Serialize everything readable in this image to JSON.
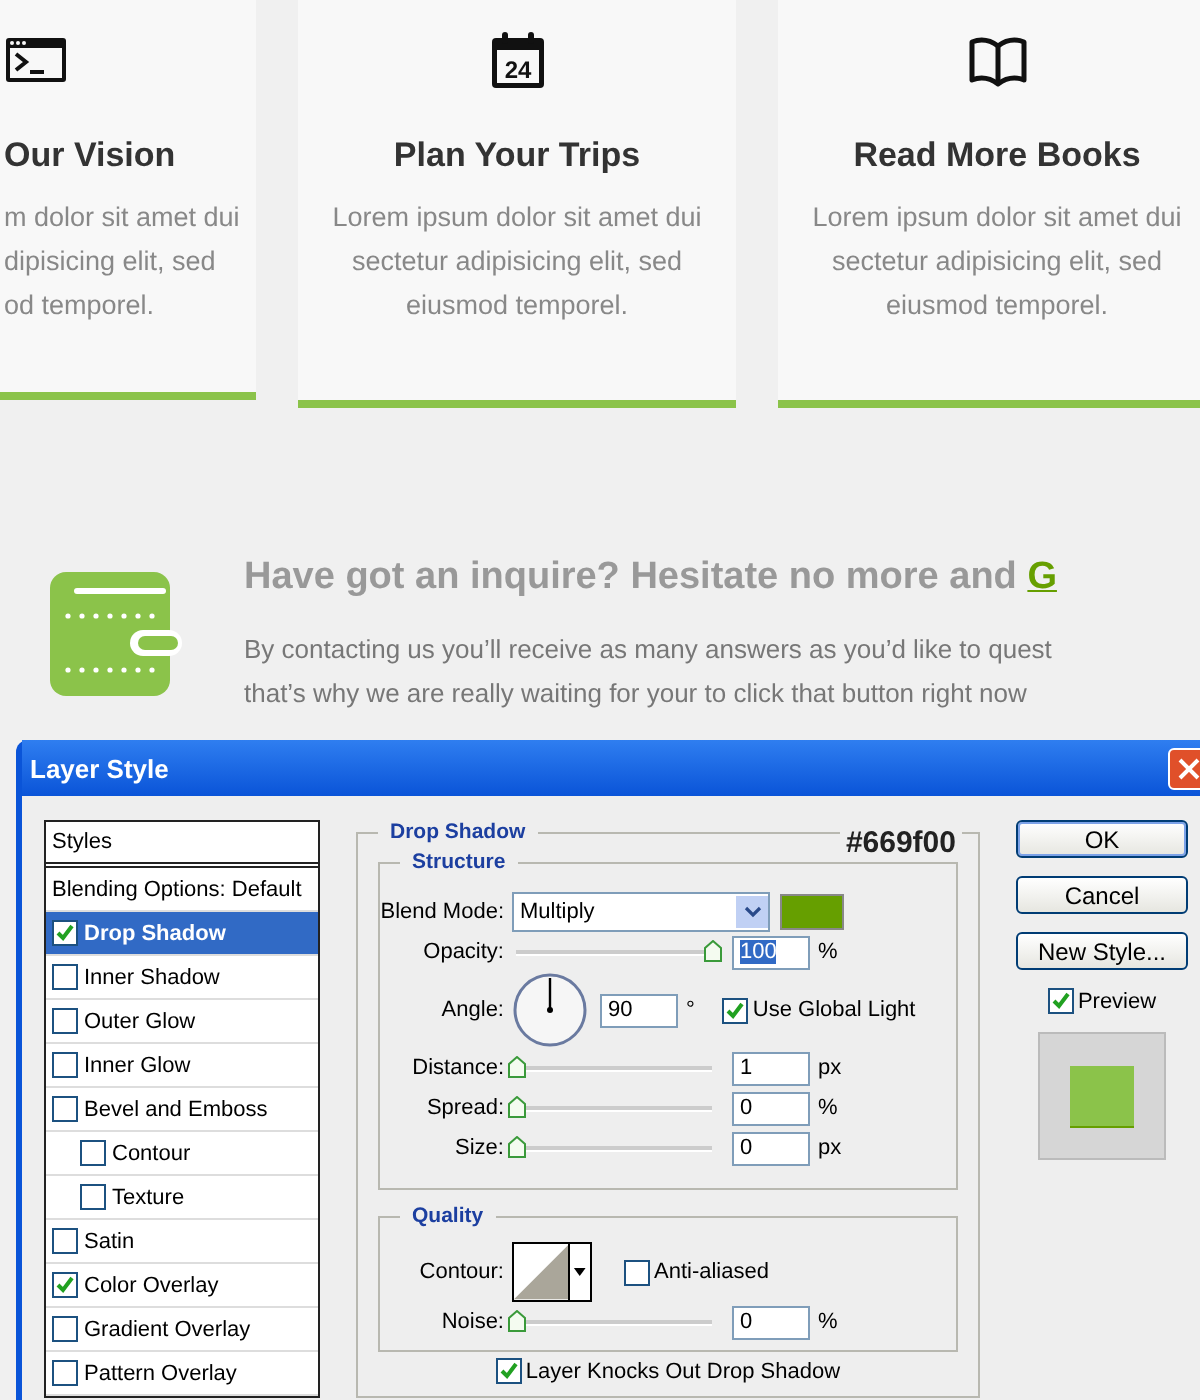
{
  "cards": [
    {
      "title": "Our Vision",
      "lines": [
        "m dolor sit amet dui",
        "dipisicing elit, sed",
        "od temporel."
      ]
    },
    {
      "icon_label": "24",
      "title": "Plan Your Trips",
      "lines": [
        "Lorem ipsum dolor sit amet dui",
        "sectetur adipisicing elit, sed",
        "eiusmod temporel."
      ]
    },
    {
      "title": "Read More Books",
      "lines": [
        "Lorem ipsum dolor sit amet dui",
        "sectetur adipisicing elit, sed",
        "eiusmod temporel."
      ]
    }
  ],
  "contact": {
    "heading": "Have got an inquire? Hesitate no more and",
    "link": "G",
    "lines": [
      "By contacting us you’ll receive as many answers as you’d like to quest",
      "that’s why we are really waiting for your to click that button right now"
    ]
  },
  "dialog": {
    "title": "Layer Style",
    "styles": [
      {
        "kind": "header",
        "label": "Styles"
      },
      {
        "kind": "plain",
        "label": "Blending Options: Default",
        "selected": false
      },
      {
        "kind": "check",
        "label": "Drop Shadow",
        "checked": true,
        "selected": true
      },
      {
        "kind": "check",
        "label": "Inner Shadow",
        "checked": false,
        "selected": false
      },
      {
        "kind": "check",
        "label": "Outer Glow",
        "checked": false,
        "selected": false
      },
      {
        "kind": "check",
        "label": "Inner Glow",
        "checked": false,
        "selected": false
      },
      {
        "kind": "check",
        "label": "Bevel and Emboss",
        "checked": false,
        "selected": false,
        "children": [
          {
            "kind": "check",
            "label": "Contour",
            "checked": false,
            "selected": false
          },
          {
            "kind": "check",
            "label": "Texture",
            "checked": false,
            "selected": false
          }
        ]
      },
      {
        "kind": "check",
        "label": "Satin",
        "checked": false,
        "selected": false
      },
      {
        "kind": "check",
        "label": "Color Overlay",
        "checked": true,
        "selected": false
      },
      {
        "kind": "check",
        "label": "Gradient Overlay",
        "checked": false,
        "selected": false
      },
      {
        "kind": "check",
        "label": "Pattern Overlay",
        "checked": false,
        "selected": false
      }
    ],
    "panel": {
      "title": "Drop Shadow",
      "note": "#669f00",
      "structure": {
        "title": "Structure",
        "rows": [
          {
            "kind": "blend",
            "label": "Blend Mode:",
            "value": "Multiply",
            "color": "#669f00"
          },
          {
            "kind": "slider",
            "label": "Opacity:",
            "level": 1,
            "value": "100",
            "value_selected": true,
            "unit": "%"
          },
          {
            "kind": "angle",
            "label": "Angle:",
            "value": "90",
            "unit": "°",
            "checkbox": {
              "label": "Use Global Light",
              "checked": true
            }
          },
          {
            "kind": "slider",
            "label": "Distance:",
            "level": 0,
            "value": "1",
            "value_selected": false,
            "unit": "px"
          },
          {
            "kind": "slider",
            "label": "Spread:",
            "level": 0,
            "value": "0",
            "value_selected": false,
            "unit": "%"
          },
          {
            "kind": "slider",
            "label": "Size:",
            "level": 0,
            "value": "0",
            "value_selected": false,
            "unit": "px"
          }
        ]
      },
      "quality": {
        "title": "Quality",
        "rows": [
          {
            "kind": "contour",
            "label": "Contour:",
            "checkbox": {
              "label": "Anti-aliased",
              "checked": false
            }
          },
          {
            "kind": "slider",
            "label": "Noise:",
            "level": 0,
            "value": "0",
            "value_selected": false,
            "unit": "%"
          }
        ]
      },
      "knockout": {
        "label": "Layer Knocks Out Drop Shadow",
        "checked": true
      }
    },
    "buttons": [
      {
        "label": "OK",
        "default": true
      },
      {
        "label": "Cancel",
        "default": false
      },
      {
        "label": "New Style...",
        "default": false
      }
    ],
    "preview": {
      "label": "Preview",
      "checked": true
    }
  }
}
